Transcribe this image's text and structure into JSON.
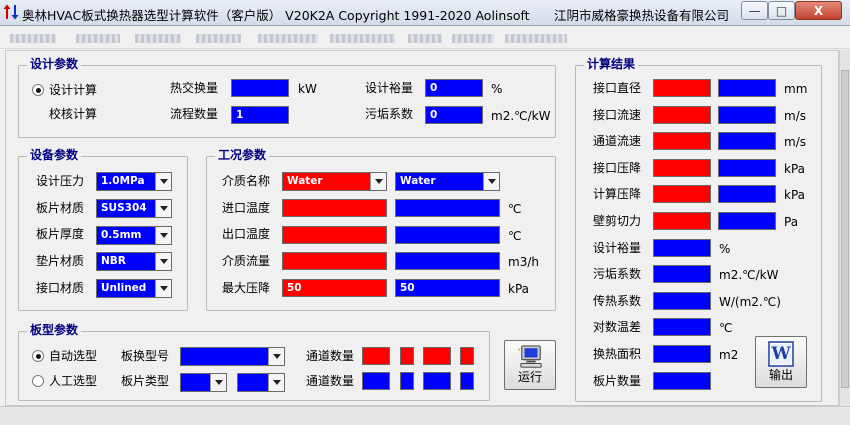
{
  "titlebar": {
    "title": "奥林HVAC板式换热器选型计算软件（客户版） V20K2A  Copyright 1991-2020  Aolinsoft",
    "company": "江阴市威格豪换热设备有限公司",
    "minimize": "—",
    "maximize": "□",
    "close": "X"
  },
  "colors": {
    "input_blue": "#0000ff",
    "result_red": "#ff0000",
    "group_title": "#00007f"
  },
  "design": {
    "title": "设计参数",
    "mode_design": "设计计算",
    "mode_check": "校核计算",
    "heat_label": "热交换量",
    "heat_value": "",
    "heat_unit": "kW",
    "pass_label": "流程数量",
    "pass_value": "1",
    "margin_label": "设计裕量",
    "margin_value": "0",
    "margin_unit": "%",
    "fouling_label": "污垢系数",
    "fouling_value": "0",
    "fouling_unit": "m2.℃/kW"
  },
  "equipment": {
    "title": "设备参数",
    "pressure_label": "设计压力",
    "pressure_value": "1.0MPa",
    "material_label": "板片材质",
    "material_value": "SUS304",
    "thickness_label": "板片厚度",
    "thickness_value": "0.5mm",
    "gasket_label": "垫片材质",
    "gasket_value": "NBR",
    "port_label": "接口材质",
    "port_value": "Unlined"
  },
  "conditions": {
    "title": "工况参数",
    "medium_label": "介质名称",
    "medium_hot": "Water",
    "medium_cold": "Water",
    "inlet_label": "进口温度",
    "inlet_unit": "℃",
    "outlet_label": "出口温度",
    "outlet_unit": "℃",
    "flow_label": "介质流量",
    "flow_unit": "m3/h",
    "maxdrop_label": "最大压降",
    "maxdrop_hot": "50",
    "maxdrop_cold": "50",
    "maxdrop_unit": "kPa"
  },
  "plate": {
    "title": "板型参数",
    "auto_label": "自动选型",
    "manual_label": "人工选型",
    "model_label": "板换型号",
    "type_label": "板片类型",
    "channel_label": "通道数量"
  },
  "results": {
    "title": "计算结果",
    "rows": [
      {
        "label": "接口直径",
        "unit": "mm"
      },
      {
        "label": "接口流速",
        "unit": "m/s"
      },
      {
        "label": "通道流速",
        "unit": "m/s"
      },
      {
        "label": "接口压降",
        "unit": "kPa"
      },
      {
        "label": "计算压降",
        "unit": "kPa"
      },
      {
        "label": "壁剪切力",
        "unit": "Pa"
      },
      {
        "label": "设计裕量",
        "unit": "%"
      },
      {
        "label": "污垢系数",
        "unit": "m2.℃/kW"
      },
      {
        "label": "传热系数",
        "unit": "W/(m2.℃)"
      },
      {
        "label": "对数温差",
        "unit": "℃"
      },
      {
        "label": "换热面积",
        "unit": "m2"
      },
      {
        "label": "板片数量",
        "unit": ""
      }
    ]
  },
  "buttons": {
    "run": "运行",
    "export": "输出",
    "export_icon_letter": "W"
  }
}
